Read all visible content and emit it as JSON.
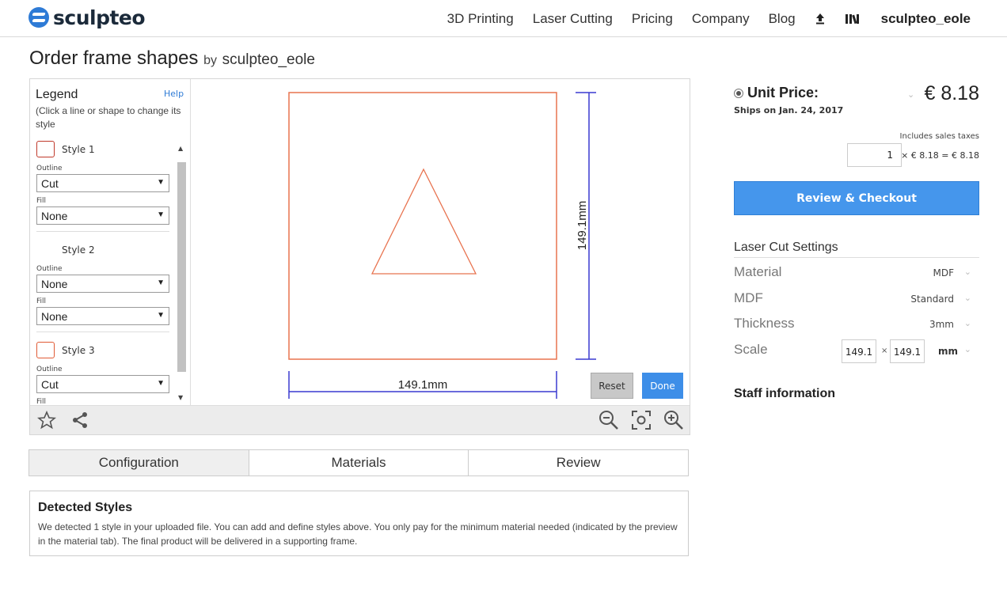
{
  "header": {
    "logo_text": "sculpteo",
    "nav": [
      "3D Printing",
      "Laser Cutting",
      "Pricing",
      "Company",
      "Blog"
    ],
    "upload_icon": "upload-icon",
    "library_icon": "library-icon",
    "username": "sculpteo_eole"
  },
  "page": {
    "title": "Order frame shapes",
    "by": "by",
    "author": "sculpteo_eole"
  },
  "legend": {
    "title": "Legend",
    "help": "Help",
    "hint": "(Click a line or shape to change its style",
    "styles": [
      {
        "name": "Style 1",
        "outline_label": "Outline",
        "outline": "Cut",
        "fill_label": "Fill",
        "fill": "None",
        "color": "#c0392b"
      },
      {
        "name": "Style 2",
        "outline_label": "Outline",
        "outline": "None",
        "fill_label": "Fill",
        "fill": "None",
        "color": ""
      },
      {
        "name": "Style 3",
        "outline_label": "Outline",
        "outline": "Cut",
        "fill_label": "Fill",
        "fill": "",
        "color": "#e05a35"
      }
    ]
  },
  "canvas": {
    "width_label": "149.1mm",
    "height_label": "149.1mm",
    "shape_color": "#e8734f",
    "dimension_color": "#3a3ad0",
    "reset": "Reset",
    "done": "Done"
  },
  "tabs": [
    "Configuration",
    "Materials",
    "Review"
  ],
  "detected": {
    "title": "Detected Styles",
    "text": "We detected 1 style in your uploaded file. You can add and define styles above. You only pay for the minimum material needed (indicated by the preview in the material tab). The final product will be delivered in a supporting frame."
  },
  "pricing": {
    "unit_price_label": "Unit Price:",
    "price": "€ 8.18",
    "ships": "Ships on Jan. 24, 2017",
    "taxes": "Includes sales taxes",
    "quantity": "1",
    "formula": "× € 8.18 = € 8.18",
    "checkout": "Review & Checkout"
  },
  "laser_settings": {
    "title": "Laser Cut Settings",
    "material_label": "Material",
    "material_value": "MDF",
    "mdf_label": "MDF",
    "mdf_value": "Standard",
    "thickness_label": "Thickness",
    "thickness_value": "3mm",
    "scale_label": "Scale",
    "scale_w": "149.1",
    "scale_x": "×",
    "scale_h": "149.1",
    "scale_unit": "mm"
  },
  "staff": "Staff information",
  "colors": {
    "accent": "#3d8ee8",
    "brand": "#2e7bd6"
  }
}
